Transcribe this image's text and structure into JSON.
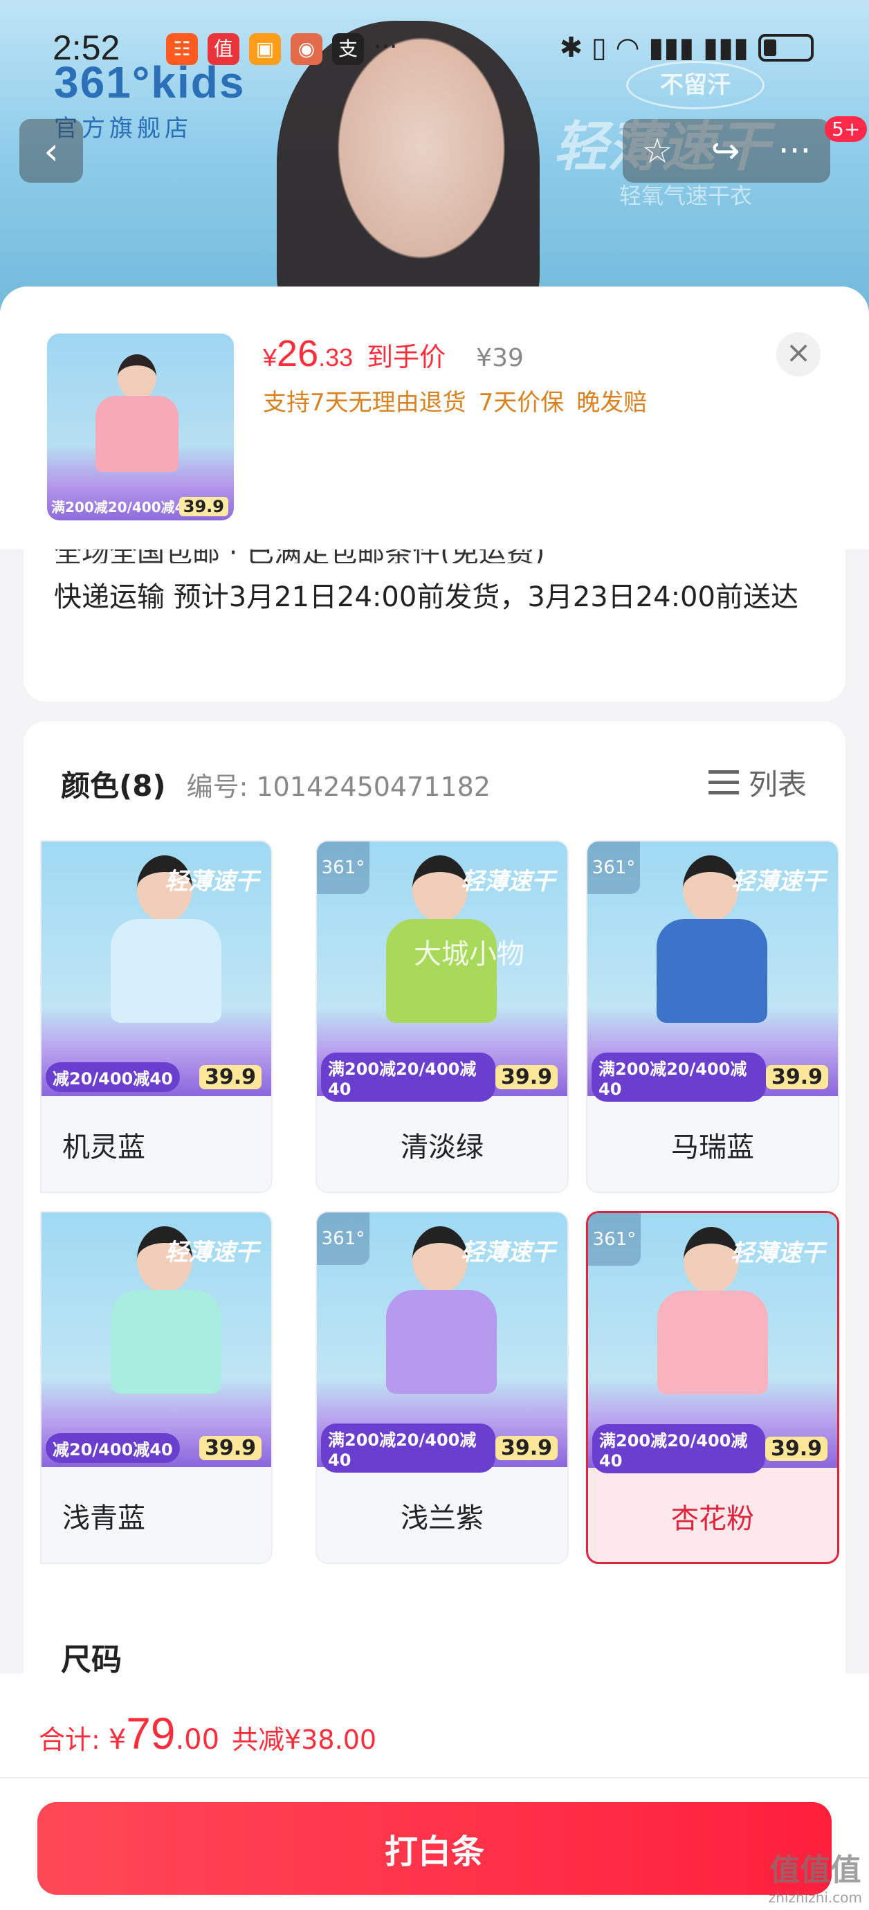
{
  "status_bar": {
    "time": "2:52",
    "app_icons": [
      {
        "name": "app-icon",
        "glyph": "☷",
        "color": "#ff5a1f"
      },
      {
        "name": "app-icon",
        "glyph": "值",
        "color": "#e8343a"
      },
      {
        "name": "app-icon",
        "glyph": "▣",
        "color": "#ff9c1a"
      },
      {
        "name": "app-icon",
        "glyph": "◉",
        "color": "#e36b4b"
      },
      {
        "name": "app-icon",
        "glyph": "支",
        "color": "#222222"
      }
    ],
    "more": "···",
    "signal_text": "✱ ▯ ◠ ▮▮▮ ▮▮▮"
  },
  "hero": {
    "logo": "361°kids",
    "shop_name": "官方旗舰店",
    "tag": "不留汗",
    "slogan": "轻薄速干",
    "subline": "轻氧气速干衣",
    "back_icon": "‹",
    "star_icon": "☆",
    "share_icon": "↪",
    "more_icon": "···",
    "badge": "5+"
  },
  "product": {
    "thumb_promo": "满200减20/400减40",
    "thumb_price": "39.9",
    "price_symbol": "¥",
    "price_int": "26",
    "price_dec": ".33",
    "price_label": "到手价",
    "original_price": "¥39",
    "promises": [
      "支持7天无理由退货",
      "7天价保",
      "晚发赔"
    ],
    "close": "×"
  },
  "shipping": {
    "cut_text": "全场全国包邮 · 已满足包邮条件(免运费)",
    "text": "快递运输 预计3月21日24:00前发货，3月23日24:00前送达"
  },
  "sku": {
    "color_title": "颜色(8)",
    "item_no": "编号: 10142450471182",
    "list_label": "列表",
    "watermark": "大城小物",
    "promo_pill": "满200减20/400减40",
    "promo_pill_cut": "减20/400减40",
    "promo_value": "39.9",
    "brand": "轻薄速干",
    "corner": "361°",
    "colors": [
      {
        "label": "机灵蓝",
        "shirt": "#d7eefb",
        "selected": false
      },
      {
        "label": "清淡绿",
        "shirt": "#a9d95b",
        "selected": false
      },
      {
        "label": "马瑞蓝",
        "shirt": "#3b74c9",
        "selected": false
      },
      {
        "label": "浅青蓝",
        "shirt": "#a9ece0",
        "selected": false
      },
      {
        "label": "浅兰紫",
        "shirt": "#b59af0",
        "selected": false
      },
      {
        "label": "杏花粉",
        "shirt": "#f8b3bf",
        "selected": true
      }
    ],
    "size_title": "尺码"
  },
  "footer": {
    "total_label": "合计:",
    "total_symbol": "¥",
    "total_int": "79",
    "total_dec": ".00",
    "savings": "共减¥38.00",
    "cta": "打白条"
  },
  "site_watermark": {
    "top": "值值值",
    "bottom": "zhizhizhi.com"
  }
}
